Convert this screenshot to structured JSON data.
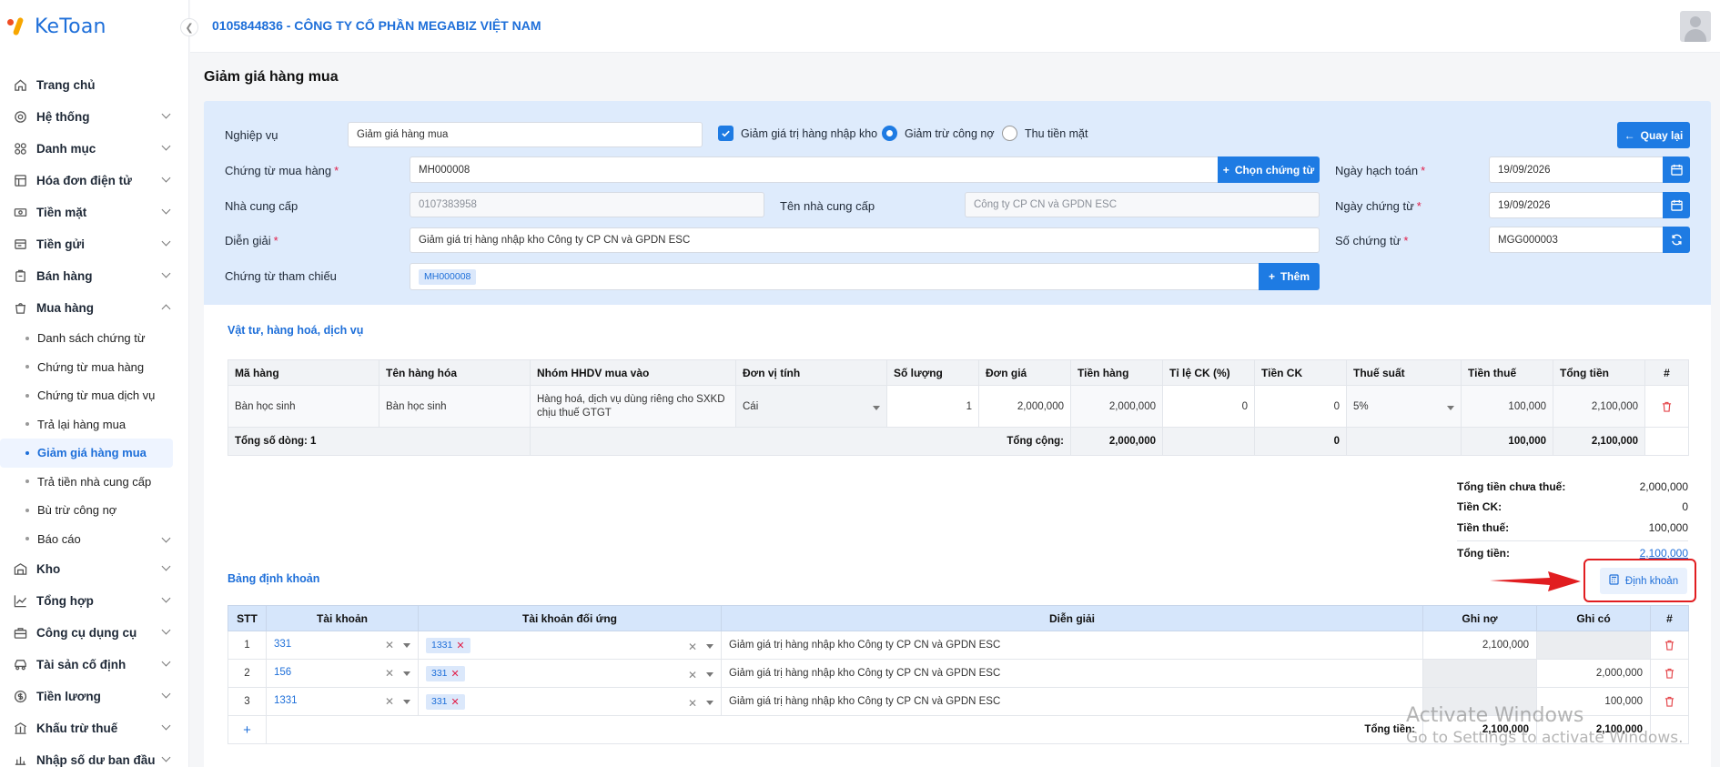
{
  "app": {
    "logo_text": "KeToan",
    "company": "0105844836 - CÔNG TY CỔ PHẦN MEGABIZ VIỆT NAM"
  },
  "sidebar": {
    "items": [
      {
        "label": "Trang chủ",
        "icon": "home-icon"
      },
      {
        "label": "Hệ thống",
        "icon": "gear-icon"
      },
      {
        "label": "Danh mục",
        "icon": "grid-icon"
      },
      {
        "label": "Hóa đơn điện tử",
        "icon": "invoice-icon"
      },
      {
        "label": "Tiền mặt",
        "icon": "cash-icon"
      },
      {
        "label": "Tiền gửi",
        "icon": "bank-icon"
      },
      {
        "label": "Bán hàng",
        "icon": "sale-icon"
      },
      {
        "label": "Mua hàng",
        "icon": "cart-icon"
      }
    ],
    "sub_items": [
      "Danh sách chứng từ",
      "Chứng từ mua hàng",
      "Chứng từ mua dịch vụ",
      "Trả lại hàng mua",
      "Giảm giá hàng mua",
      "Trả tiền nhà cung cấp",
      "Bù trừ công nợ",
      "Báo cáo"
    ],
    "items_after": [
      {
        "label": "Kho",
        "icon": "warehouse-icon"
      },
      {
        "label": "Tổng hợp",
        "icon": "chart-icon"
      },
      {
        "label": "Công cụ dụng cụ",
        "icon": "tools-icon"
      },
      {
        "label": "Tài sản cố định",
        "icon": "car-icon"
      },
      {
        "label": "Tiền lương",
        "icon": "salary-icon"
      },
      {
        "label": "Khấu trừ thuế",
        "icon": "tax-icon"
      },
      {
        "label": "Nhập số dư ban đầu",
        "icon": "balance-icon"
      }
    ]
  },
  "page": {
    "title": "Giảm giá hàng mua"
  },
  "form": {
    "nghiep_vu_label": "Nghiệp vụ",
    "nghiep_vu_value": "Giảm giá hàng mua",
    "chk_nhap_kho": "Giảm giá trị hàng nhập kho",
    "radio_cong_no": "Giảm trừ công nợ",
    "radio_tien_mat": "Thu tiền mặt",
    "back_label": "Quay lại",
    "chung_tu_label": "Chứng từ mua hàng",
    "chung_tu_value": "MH000008",
    "chon_chung_tu": "Chọn chứng từ",
    "ngay_hach_toan_label": "Ngày hạch toán",
    "ngay_hach_toan": "19/09/2026",
    "ncc_label": "Nhà cung cấp",
    "ncc_value": "0107383958",
    "ten_ncc_label": "Tên nhà cung cấp",
    "ten_ncc_value": "Công ty CP CN và GPDN ESC",
    "ngay_chung_tu_label": "Ngày chứng từ",
    "ngay_chung_tu": "19/09/2026",
    "dien_giai_label": "Diễn giải",
    "dien_giai_value": "Giảm giá trị hàng nhập kho Công ty CP CN và GPDN ESC",
    "so_chung_tu_label": "Số chứng từ",
    "so_chung_tu": "MGG000003",
    "tham_chieu_label": "Chứng từ tham chiếu",
    "tham_chieu_tag": "MH000008",
    "them_label": "Thêm"
  },
  "goods": {
    "section_title": "Vật tư, hàng hoá, dịch vụ",
    "headers": [
      "Mã hàng",
      "Tên hàng hóa",
      "Nhóm HHDV mua vào",
      "Đơn vị tính",
      "Số lượng",
      "Đơn giá",
      "Tiền hàng",
      "Tỉ lệ CK (%)",
      "Tiền CK",
      "Thuế suất",
      "Tiền thuế",
      "Tổng tiền",
      "#"
    ],
    "row": {
      "ma_hang": "Bàn học sinh",
      "ten_hang": "Bàn học sinh",
      "nhom": "Hàng hoá, dịch vụ dùng riêng cho SXKD chịu thuế GTGT",
      "dvt": "Cái",
      "so_luong": "1",
      "don_gia": "2,000,000",
      "tien_hang": "2,000,000",
      "ti_le_ck": "0",
      "tien_ck": "0",
      "thue_suat": "5%",
      "tien_thue": "100,000",
      "tong_tien": "2,100,000"
    },
    "total": {
      "so_dong": "Tổng số dòng: 1",
      "tong_cong_label": "Tổng cộng:",
      "tien_hang": "2,000,000",
      "tien_ck": "0",
      "tien_thue": "100,000",
      "tong_tien": "2,100,000"
    }
  },
  "summary": [
    {
      "label": "Tổng tiền chưa thuế:",
      "value": "2,000,000"
    },
    {
      "label": "Tiền CK:",
      "value": "0"
    },
    {
      "label": "Tiền thuế:",
      "value": "100,000"
    },
    {
      "label": "Tổng tiền:",
      "value": "2,100,000"
    }
  ],
  "accounting": {
    "section_title": "Bảng định khoản",
    "button_label": "Định khoản",
    "headers": [
      "STT",
      "Tài khoản",
      "Tài khoản đối ứng",
      "Diễn giải",
      "Ghi nợ",
      "Ghi có",
      "#"
    ],
    "rows": [
      {
        "stt": "1",
        "tk": "331",
        "tk_du": "1331",
        "dien_giai": "Giảm giá trị hàng nhập kho Công ty CP CN và GPDN ESC",
        "ghi_no": "2,100,000",
        "ghi_co": ""
      },
      {
        "stt": "2",
        "tk": "156",
        "tk_du": "331",
        "dien_giai": "Giảm giá trị hàng nhập kho Công ty CP CN và GPDN ESC",
        "ghi_no": "",
        "ghi_co": "2,000,000"
      },
      {
        "stt": "3",
        "tk": "1331",
        "tk_du": "331",
        "dien_giai": "Giảm giá trị hàng nhập kho Công ty CP CN và GPDN ESC",
        "ghi_no": "",
        "ghi_co": "100,000"
      }
    ],
    "total_label": "Tổng tiền:",
    "total_no": "2,100,000",
    "total_co": "2,100,000",
    "add_symbol": "+"
  },
  "watermark": {
    "line1": "Activate Windows",
    "line2": "Go to Settings to activate Windows."
  }
}
